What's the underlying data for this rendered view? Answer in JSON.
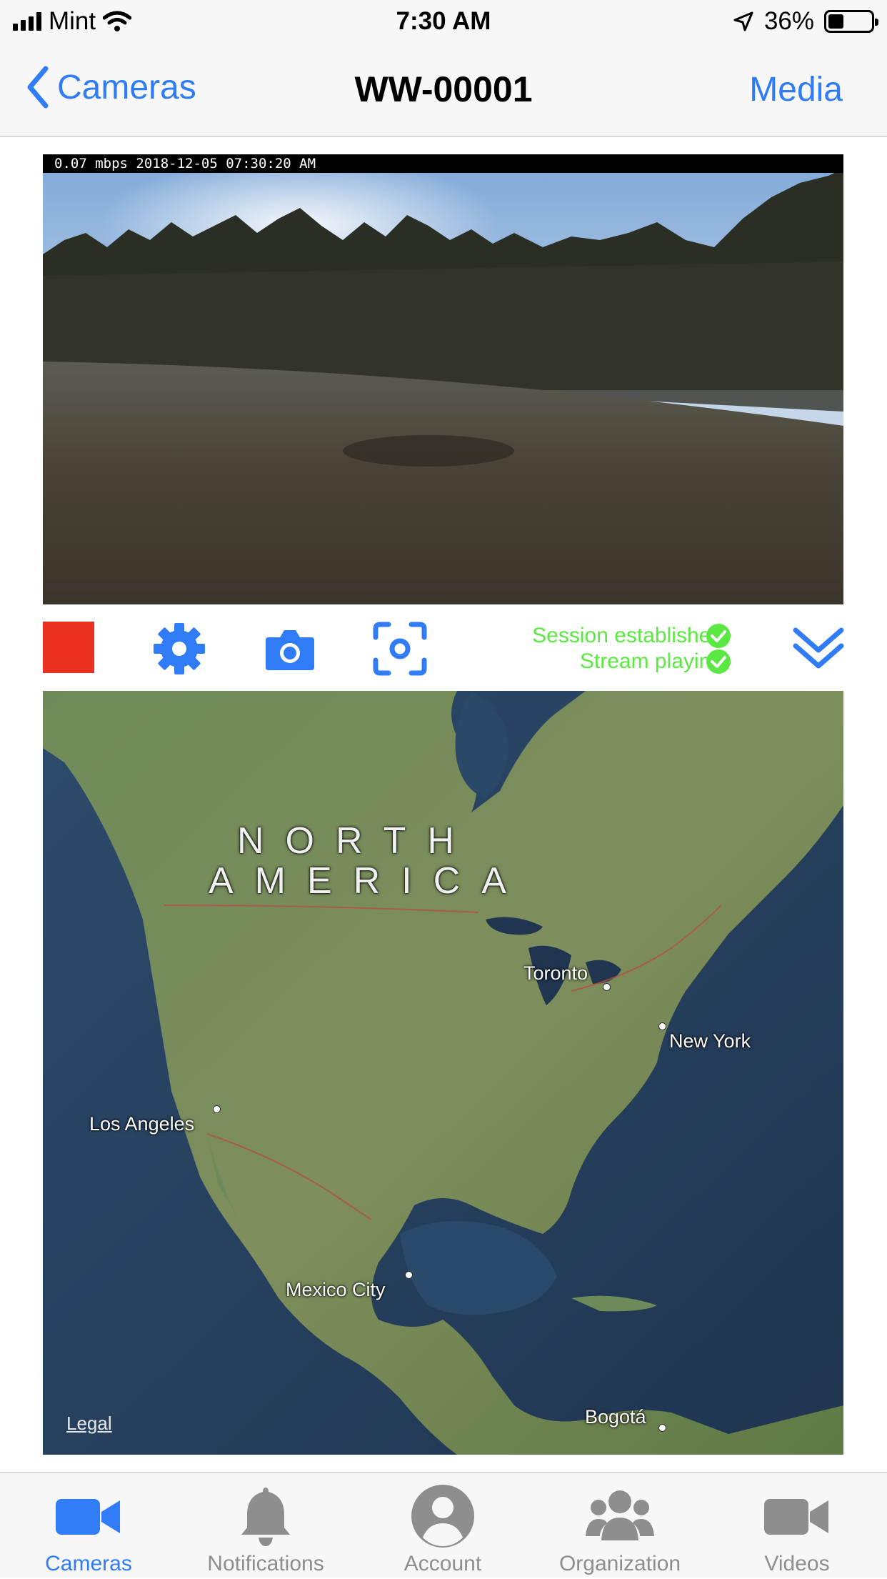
{
  "status_bar": {
    "carrier": "Mint",
    "time": "7:30 AM",
    "battery_percent": "36%",
    "battery_level": 0.36,
    "icons": [
      "signal-icon",
      "wifi-icon",
      "location-arrow-icon",
      "battery-icon"
    ]
  },
  "nav": {
    "back_label": "Cameras",
    "title": "WW-00001",
    "right_label": "Media",
    "accent_color": "#2f7cf6"
  },
  "video": {
    "overlay_text": "0.07 mbps 2018-12-05 07:30:20 AM"
  },
  "controls": {
    "stop_color": "#e8321f",
    "icons": [
      "stop-icon",
      "gear-icon",
      "camera-icon",
      "focus-icon",
      "chevron-double-down-icon"
    ],
    "statuses": [
      {
        "text": "Session established",
        "icon": "check-circle-icon"
      },
      {
        "text": "Stream playing",
        "icon": "check-circle-icon"
      }
    ],
    "status_color": "#5ce842"
  },
  "map": {
    "continent_line1": "NORTH",
    "continent_line2": "AMERICA",
    "cities": {
      "toronto": "Toronto",
      "new_york": "New York",
      "los_angeles": "Los Angeles",
      "mexico_city": "Mexico City",
      "bogota": "Bogotá"
    },
    "legal": "Legal"
  },
  "tabs": [
    {
      "label": "Cameras",
      "icon": "video-camera-icon",
      "active": true
    },
    {
      "label": "Notifications",
      "icon": "bell-icon",
      "active": false
    },
    {
      "label": "Account",
      "icon": "user-circle-icon",
      "active": false
    },
    {
      "label": "Organization",
      "icon": "users-icon",
      "active": false
    },
    {
      "label": "Videos",
      "icon": "video-camera-icon",
      "active": false
    }
  ]
}
